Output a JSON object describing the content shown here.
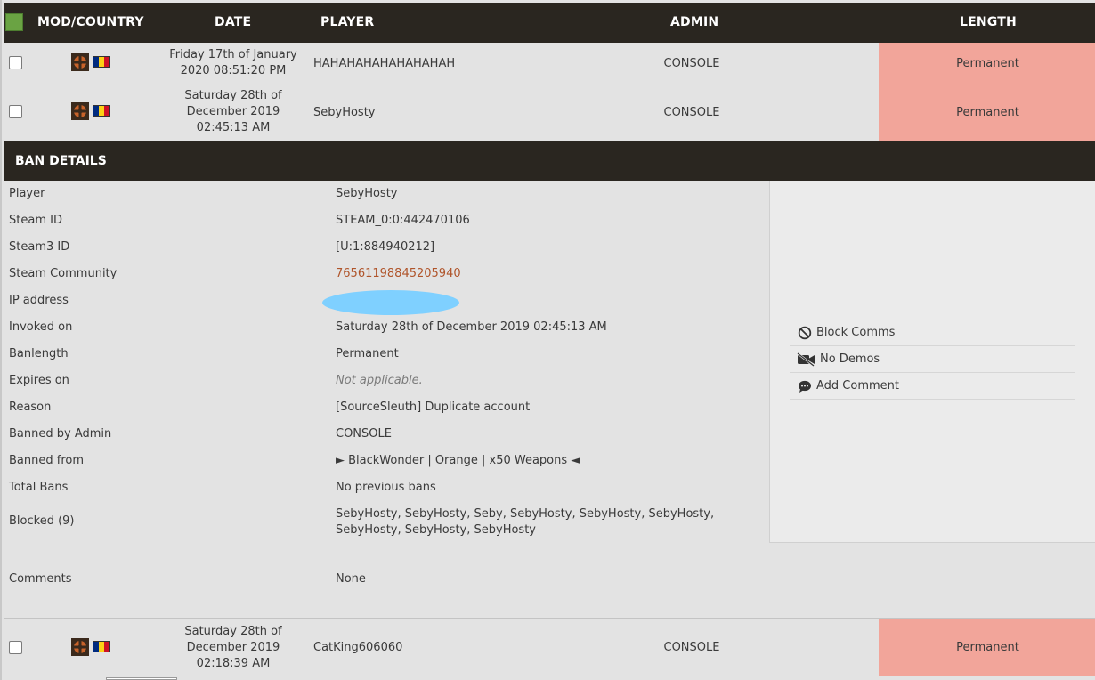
{
  "header": {
    "mod_country": "MOD/COUNTRY",
    "date": "DATE",
    "player": "PLAYER",
    "admin": "ADMIN",
    "length": "LENGTH"
  },
  "rows": [
    {
      "date_line1": "Friday 17th of January",
      "date_line2": "2020 08:51:20 PM",
      "date_line3": "",
      "player": "HAHAHAHAHAHAHAHAH",
      "admin": "CONSOLE",
      "length": "Permanent"
    },
    {
      "date_line1": "Saturday 28th of",
      "date_line2": "December 2019",
      "date_line3": "02:45:13 AM",
      "player": "SebyHosty",
      "admin": "CONSOLE",
      "length": "Permanent"
    },
    {
      "date_line1": "Saturday 28th of",
      "date_line2": "December 2019",
      "date_line3": "02:18:39 AM",
      "player": "CatKing606060",
      "admin": "CONSOLE",
      "length": "Permanent"
    }
  ],
  "details": {
    "title": "BAN DETAILS",
    "fields": [
      {
        "label": "Player",
        "value": "SebyHosty"
      },
      {
        "label": "Steam ID",
        "value": "STEAM_0:0:442470106"
      },
      {
        "label": "Steam3 ID",
        "value": "[U:1:884940212]"
      },
      {
        "label": "Steam Community",
        "value": "76561198845205940"
      },
      {
        "label": "IP address",
        "value": ""
      },
      {
        "label": "Invoked on",
        "value": "Saturday 28th of December 2019 02:45:13 AM"
      },
      {
        "label": "Banlength",
        "value": "Permanent"
      },
      {
        "label": "Expires on",
        "value": "Not applicable."
      },
      {
        "label": "Reason",
        "value": "[SourceSleuth] Duplicate account"
      },
      {
        "label": "Banned by Admin",
        "value": "CONSOLE"
      },
      {
        "label": "Banned from",
        "value": "► BlackWonder | Orange | x50 Weapons ◄"
      },
      {
        "label": "Total Bans",
        "value": "No previous bans"
      },
      {
        "label": "Blocked (9)",
        "value": "SebyHosty, SebyHosty, Seby, SebyHosty, SebyHosty, SebyHosty, SebyHosty, SebyHosty, SebyHosty"
      },
      {
        "label": "Comments",
        "value": "None"
      }
    ],
    "actions": [
      {
        "label": "Block Comms",
        "icon": "block-icon"
      },
      {
        "label": "No Demos",
        "icon": "no-video-icon"
      },
      {
        "label": "Add Comment",
        "icon": "comment-icon"
      }
    ]
  },
  "colors": {
    "header_bg": "#2a2620",
    "length_bg": "#f2a59a",
    "link": "#b0552b",
    "select_all": "#6aa343"
  }
}
